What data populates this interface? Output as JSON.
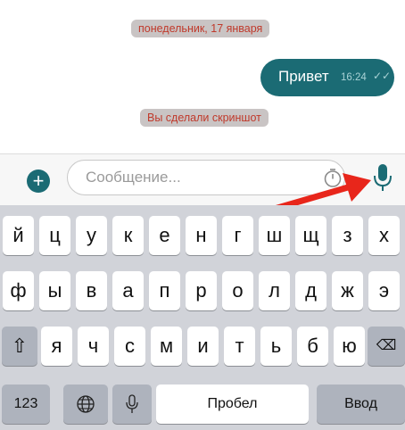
{
  "chat": {
    "date_label": "понедельник, 17 января",
    "message_text": "Привет",
    "message_time": "16:24",
    "message_status": "✓✓",
    "screenshot_notice": "Вы сделали скриншот"
  },
  "composer": {
    "add_glyph": "+",
    "placeholder": "Сообщение..."
  },
  "keyboard": {
    "row1": [
      "й",
      "ц",
      "у",
      "к",
      "е",
      "н",
      "г",
      "ш",
      "щ",
      "з",
      "х"
    ],
    "row2": [
      "ф",
      "ы",
      "в",
      "а",
      "п",
      "р",
      "о",
      "л",
      "д",
      "ж",
      "э"
    ],
    "row3": [
      "я",
      "ч",
      "с",
      "м",
      "и",
      "т",
      "ь",
      "б",
      "ю"
    ],
    "numbers_label": "123",
    "space_label": "Пробел",
    "return_label": "Ввод",
    "shift_glyph": "⇧",
    "delete_glyph": "⌫"
  },
  "colors": {
    "accent": "#1b6b74",
    "notice_text": "#c0392b",
    "arrow": "#e8261b"
  }
}
